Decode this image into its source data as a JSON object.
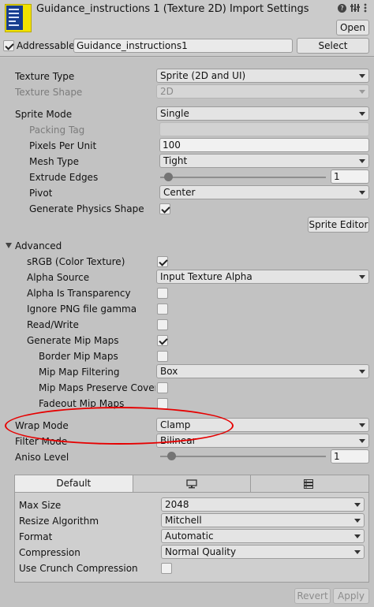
{
  "header": {
    "title": "Guidance_instructions 1 (Texture 2D) Import Settings",
    "open_label": "Open",
    "addressable_label": "Addressable",
    "addressable_checked": true,
    "address_value": "Guidance_instructions1",
    "select_label": "Select"
  },
  "texture": {
    "type_label": "Texture Type",
    "type_value": "Sprite (2D and UI)",
    "shape_label": "Texture Shape",
    "shape_value": "2D"
  },
  "sprite": {
    "mode_label": "Sprite Mode",
    "mode_value": "Single",
    "packing_tag_label": "Packing Tag",
    "packing_tag_value": "",
    "ppu_label": "Pixels Per Unit",
    "ppu_value": "100",
    "mesh_type_label": "Mesh Type",
    "mesh_type_value": "Tight",
    "extrude_label": "Extrude Edges",
    "extrude_value": "1",
    "pivot_label": "Pivot",
    "pivot_value": "Center",
    "physics_label": "Generate Physics Shape",
    "physics_checked": true,
    "editor_label": "Sprite Editor"
  },
  "advanced": {
    "label": "Advanced",
    "srgb_label": "sRGB (Color Texture)",
    "srgb_checked": true,
    "alpha_source_label": "Alpha Source",
    "alpha_source_value": "Input Texture Alpha",
    "alpha_transp_label": "Alpha Is Transparency",
    "alpha_transp_checked": false,
    "ignore_png_label": "Ignore PNG file gamma",
    "ignore_png_checked": false,
    "readwrite_label": "Read/Write",
    "readwrite_checked": false,
    "mipmaps_label": "Generate Mip Maps",
    "mipmaps_checked": true,
    "border_mip_label": "Border Mip Maps",
    "border_mip_checked": false,
    "mip_filter_label": "Mip Map Filtering",
    "mip_filter_value": "Box",
    "mip_preserve_label": "Mip Maps Preserve Covera",
    "mip_preserve_checked": false,
    "fadeout_label": "Fadeout Mip Maps",
    "fadeout_checked": false
  },
  "wrap": {
    "label": "Wrap Mode",
    "value": "Clamp"
  },
  "filter": {
    "label": "Filter Mode",
    "value": "Bilinear"
  },
  "aniso": {
    "label": "Aniso Level",
    "value": "1"
  },
  "platform": {
    "tabs": [
      "Default",
      "monitor-icon",
      "server-icon"
    ],
    "max_size_label": "Max Size",
    "max_size_value": "2048",
    "resize_label": "Resize Algorithm",
    "resize_value": "Mitchell",
    "format_label": "Format",
    "format_value": "Automatic",
    "compression_label": "Compression",
    "compression_value": "Normal Quality",
    "crunch_label": "Use Crunch Compression",
    "crunch_checked": false
  },
  "footer": {
    "revert_label": "Revert",
    "apply_label": "Apply"
  },
  "annotation_color": "#e60000"
}
